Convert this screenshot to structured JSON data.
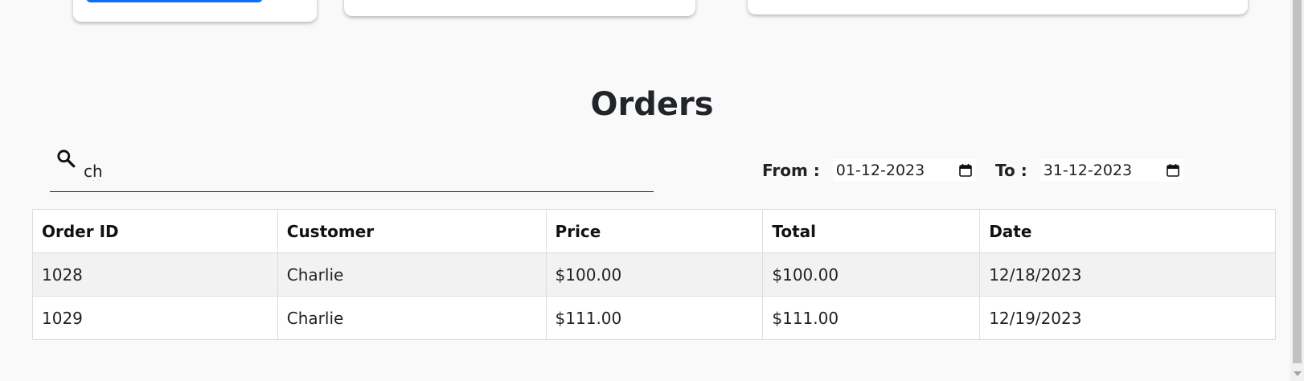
{
  "page": {
    "title": "Orders"
  },
  "search": {
    "value": "ch",
    "icon": "search-icon"
  },
  "filters": {
    "from_label": "From :",
    "from_value": "01-12-2023",
    "to_label": "To :",
    "to_value": "31-12-2023"
  },
  "table": {
    "headers": [
      "Order ID",
      "Customer",
      "Price",
      "Total",
      "Date"
    ],
    "rows": [
      [
        "1028",
        "Charlie",
        "$100.00",
        "$100.00",
        "12/18/2023"
      ],
      [
        "1029",
        "Charlie",
        "$111.00",
        "$111.00",
        "12/19/2023"
      ]
    ]
  },
  "colors": {
    "accent": "#0d6efd",
    "background": "#f9f9f9",
    "row_stripe": "#f2f2f2"
  }
}
